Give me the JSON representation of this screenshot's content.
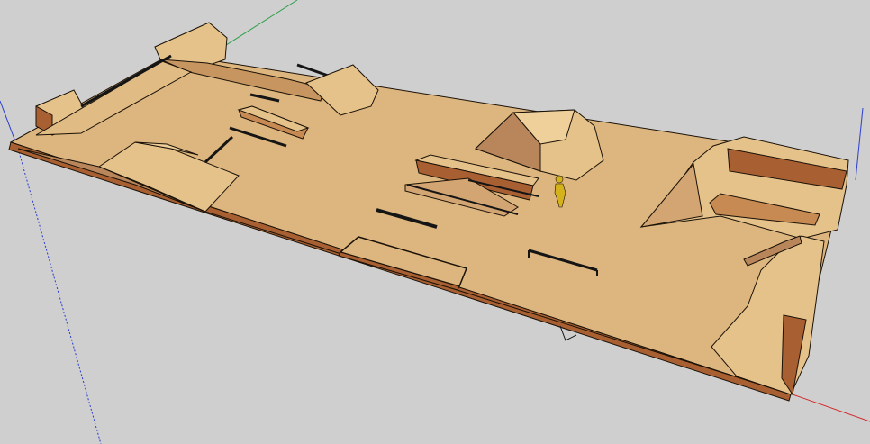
{
  "viewport": {
    "background_color": "#cfcfcf",
    "axes": {
      "red_axis_color": "#d22828",
      "green_axis_color": "#2fa04a",
      "blue_axis_color": "#2a3ccf"
    }
  },
  "model": {
    "colors": {
      "deck": "#ddb57e",
      "ramp_face": "#e6c28b",
      "ramp_shadow": "#b8865a",
      "side_wall": "#a85f32",
      "edge": "#1a1208",
      "rail": "#151515",
      "figure": "#d4b21c"
    },
    "parts": [
      "ground-deck",
      "front-side-wall",
      "left-quarter-pipe",
      "left-pyramid-ramp",
      "back-left-ledge",
      "back-left-rail",
      "center-funbox",
      "center-grind-rail",
      "ground-manual-pad",
      "flat-rail-right",
      "center-pyramid",
      "right-bowl-quarter-pipe",
      "right-bank-ramp",
      "right-front-quarter-pipe",
      "scale-figure"
    ]
  }
}
